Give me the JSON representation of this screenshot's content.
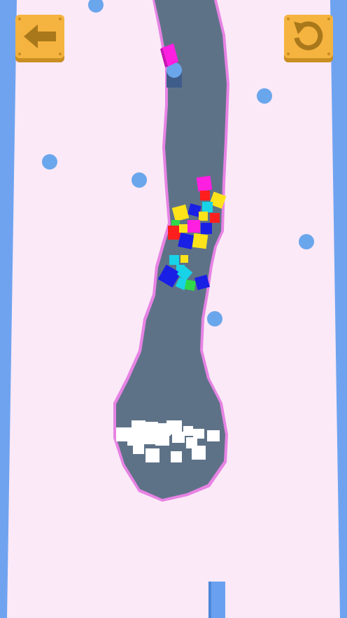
{
  "game": {
    "colors": {
      "background": "#fbe9f7",
      "side_wall": "#6fa3f0",
      "dug_path": "#5e7287",
      "path_edge": "#e783e4",
      "peg": "#6aa6ec",
      "button_face": "#f5b33f",
      "button_icon": "#a9781a",
      "goal_marker": "#69a1f0"
    },
    "hud": {
      "back_button": {
        "icon": "arrow-left-icon"
      },
      "restart_button": {
        "icon": "restart-icon"
      }
    },
    "cube_colors": [
      "#ff1fe0",
      "#ffe31a",
      "#1a1fe6",
      "#ff1e1e",
      "#18d3e8",
      "#2fd84a",
      "#ffffff"
    ]
  }
}
